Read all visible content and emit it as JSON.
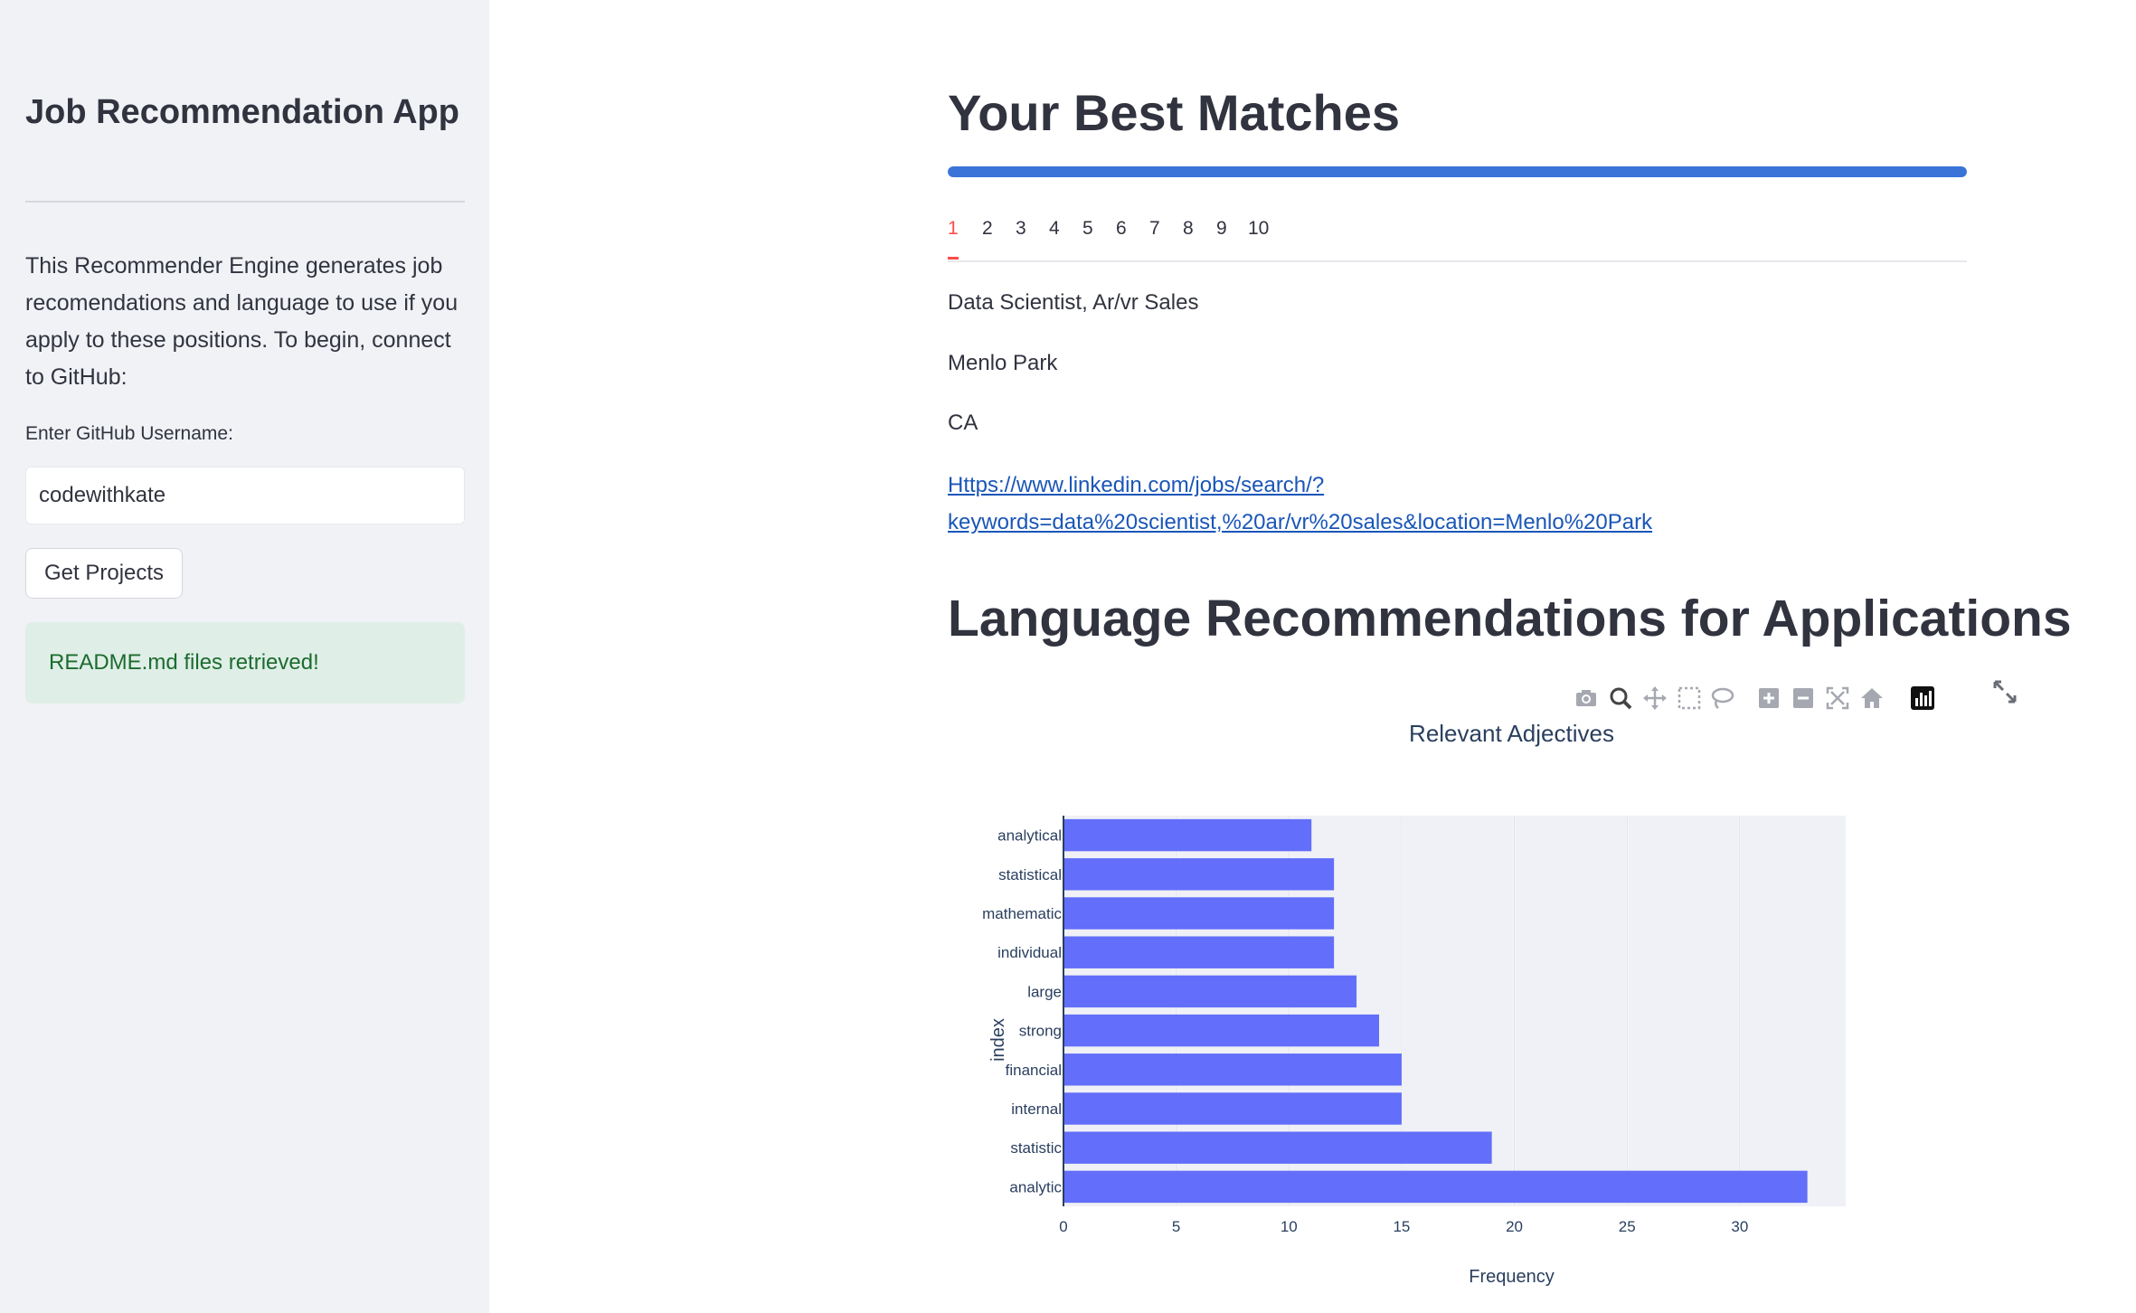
{
  "sidebar": {
    "title": "Job Recommendation App",
    "description": "This Recommender Engine generates job recomendations and language to use if you apply to these positions. To begin, connect to GitHub:",
    "username_label": "Enter GitHub Username:",
    "username_value": "codewithkate",
    "get_projects_label": "Get Projects",
    "success_message": "README.md files retrieved!"
  },
  "main": {
    "title": "Your Best Matches",
    "progress_value": 1.0,
    "tabs": [
      "1",
      "2",
      "3",
      "4",
      "5",
      "6",
      "7",
      "8",
      "9",
      "10"
    ],
    "active_tab": "1",
    "job": {
      "title": "Data Scientist, Ar/vr Sales",
      "city": "Menlo Park",
      "state": "CA",
      "link_line1": "Https://www.linkedin.com/jobs/search/?",
      "link_line2": "keywords=data%20scientist,%20ar/vr%20sales&location=Menlo%20Park"
    },
    "section_title": "Language Recommendations for Applications"
  },
  "modebar": {
    "icons": [
      "camera-icon",
      "zoom-icon",
      "pan-icon",
      "box-select-icon",
      "lasso-select-icon",
      "zoom-in-icon",
      "zoom-out-icon",
      "autoscale-icon",
      "reset-axes-icon",
      "plotly-logo-icon"
    ],
    "expand_icon": "fullscreen-icon"
  },
  "chart_data": {
    "type": "bar",
    "orientation": "horizontal",
    "title": "Relevant Adjectives",
    "xlabel": "Frequency",
    "ylabel": "index",
    "categories": [
      "analytical",
      "statistical",
      "mathematic",
      "individual",
      "large",
      "strong",
      "financial",
      "internal",
      "statistic",
      "analytic"
    ],
    "values": [
      11,
      12,
      12,
      12,
      13,
      14,
      15,
      15,
      19,
      33
    ],
    "xlim": [
      0,
      34.7
    ],
    "xticks": [
      0,
      5,
      10,
      15,
      20,
      25,
      30
    ],
    "bar_color": "#636efa",
    "plot_bg": "#eff1f6",
    "grid": true
  }
}
